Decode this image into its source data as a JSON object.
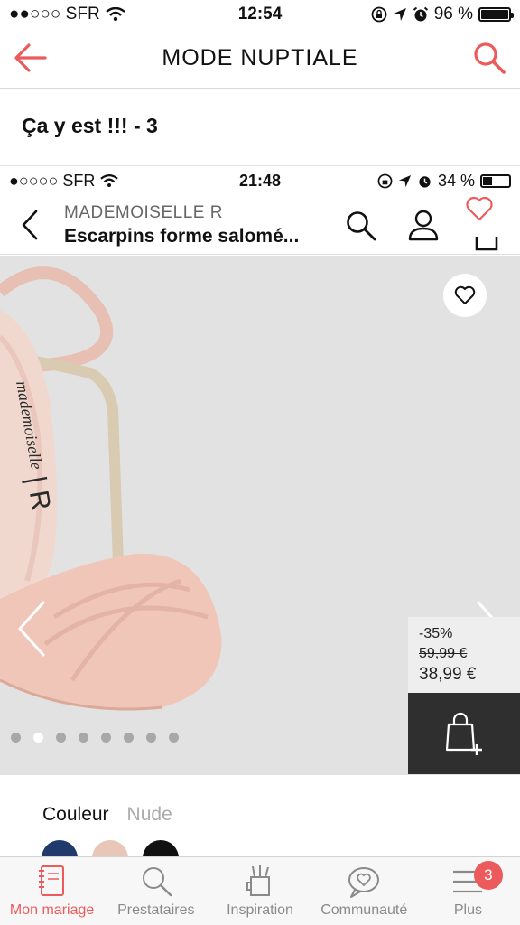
{
  "status_bar": {
    "carrier": "●●○○○ SFR",
    "time": "12:54",
    "battery_pct": "96 %"
  },
  "header": {
    "title": "MODE NUPTIALE"
  },
  "thread": {
    "title": "Ça y est !!! - 3"
  },
  "screenshot": {
    "status_bar": {
      "carrier": "●○○○○ SFR",
      "time": "21:48",
      "battery_pct": "34 %"
    },
    "product": {
      "brand": "MADEMOISELLE R",
      "name": "Escarpins forme salomé..."
    },
    "gallery": {
      "discount": "-35%",
      "old_price": "59,99 €",
      "new_price": "38,99 €",
      "dot_count": 8,
      "active_dot": 1
    },
    "color": {
      "label": "Couleur",
      "value": "Nude",
      "swatches": [
        "#1f3a6b",
        "#e8c6b8",
        "#111111"
      ]
    }
  },
  "tabbar": {
    "items": [
      {
        "label": "Mon mariage",
        "icon": "notebook-icon",
        "active": true
      },
      {
        "label": "Prestataires",
        "icon": "search-icon",
        "active": false
      },
      {
        "label": "Inspiration",
        "icon": "inspiration-cup-icon",
        "active": false
      },
      {
        "label": "Communauté",
        "icon": "heart-bubble-icon",
        "active": false
      },
      {
        "label": "Plus",
        "icon": "menu-icon",
        "active": false,
        "badge": "3"
      }
    ]
  },
  "colors": {
    "accent": "#ec5b5b",
    "gallery_bg": "#e2e2e2",
    "cart_bg": "#2f2f2f"
  }
}
